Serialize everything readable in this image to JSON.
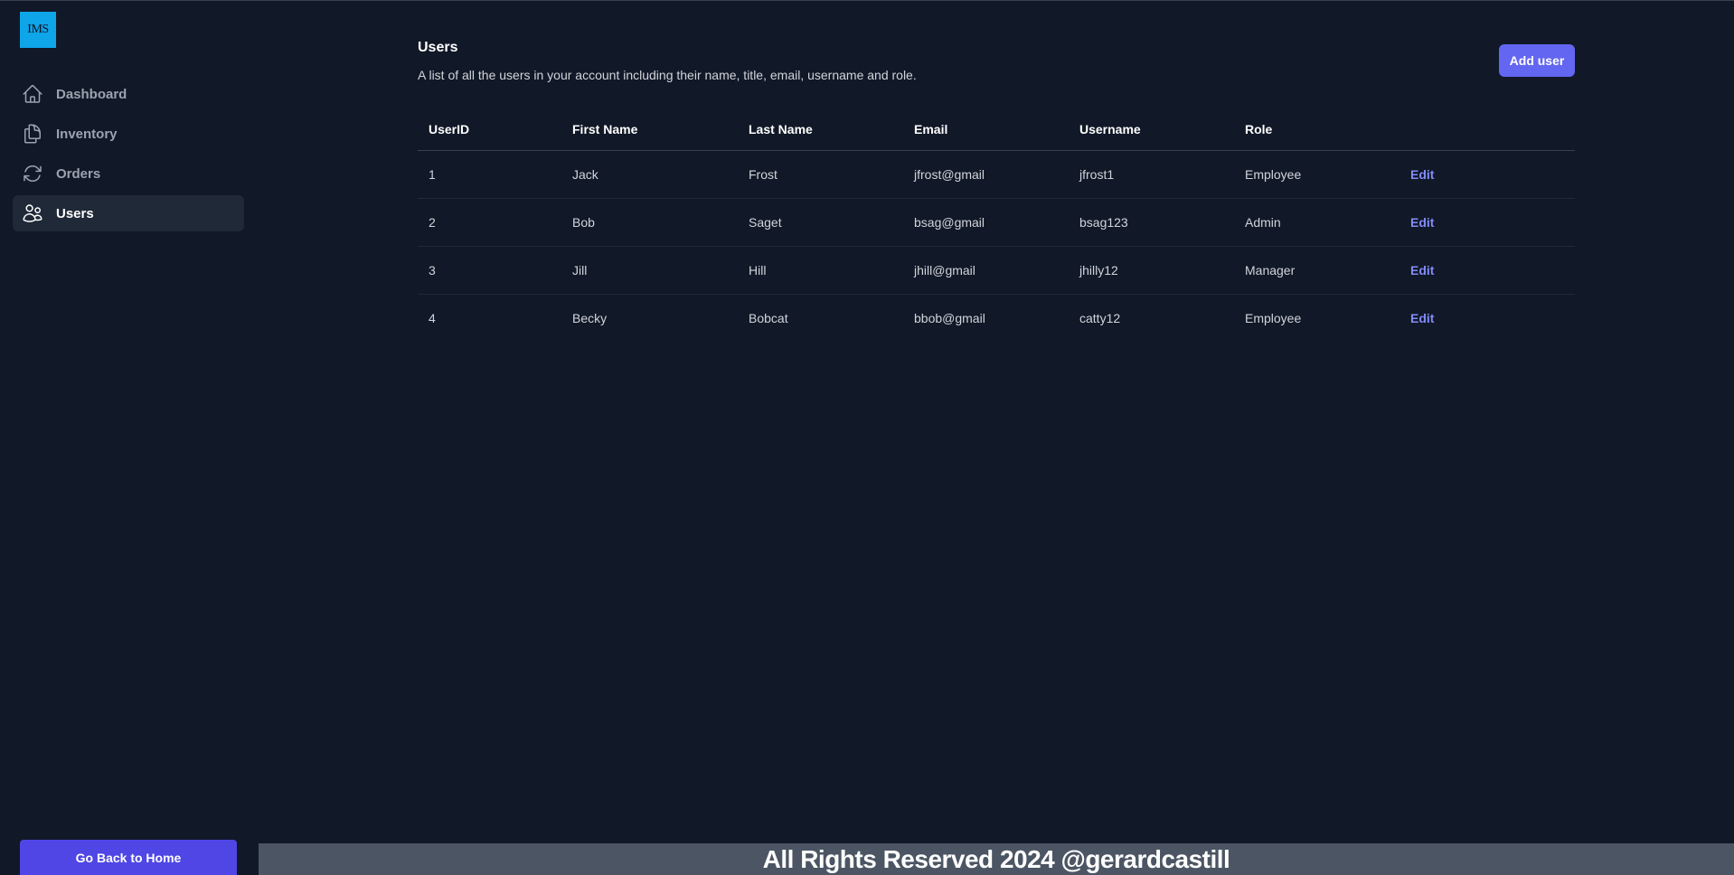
{
  "app": {
    "logo_text": "IMS"
  },
  "sidebar": {
    "items": [
      {
        "label": "Dashboard",
        "icon": "home-icon",
        "active": false
      },
      {
        "label": "Inventory",
        "icon": "documents-icon",
        "active": false
      },
      {
        "label": "Orders",
        "icon": "refresh-icon",
        "active": false
      },
      {
        "label": "Users",
        "icon": "users-icon",
        "active": true
      }
    ],
    "home_button_label": "Go Back to Home"
  },
  "main": {
    "title": "Users",
    "description": "A list of all the users in your account including their name, title, email, username and role.",
    "add_button_label": "Add user",
    "table": {
      "headers": [
        "UserID",
        "First Name",
        "Last Name",
        "Email",
        "Username",
        "Role"
      ],
      "rows": [
        {
          "id": "1",
          "first": "Jack",
          "last": "Frost",
          "email": "jfrost@gmail",
          "username": "jfrost1",
          "role": "Employee",
          "action": "Edit"
        },
        {
          "id": "2",
          "first": "Bob",
          "last": "Saget",
          "email": "bsag@gmail",
          "username": "bsag123",
          "role": "Admin",
          "action": "Edit"
        },
        {
          "id": "3",
          "first": "Jill",
          "last": "Hill",
          "email": "jhill@gmail",
          "username": "jhilly12",
          "role": "Manager",
          "action": "Edit"
        },
        {
          "id": "4",
          "first": "Becky",
          "last": "Bobcat",
          "email": "bbob@gmail",
          "username": "catty12",
          "role": "Employee",
          "action": "Edit"
        }
      ]
    }
  },
  "footer": {
    "text": "All Rights Reserved 2024 @gerardcastill"
  },
  "colors": {
    "background": "#111827",
    "accent": "#6366f1",
    "link": "#818cf8",
    "footer_bg": "#4b5563",
    "logo_bg": "#0ea5e9"
  }
}
